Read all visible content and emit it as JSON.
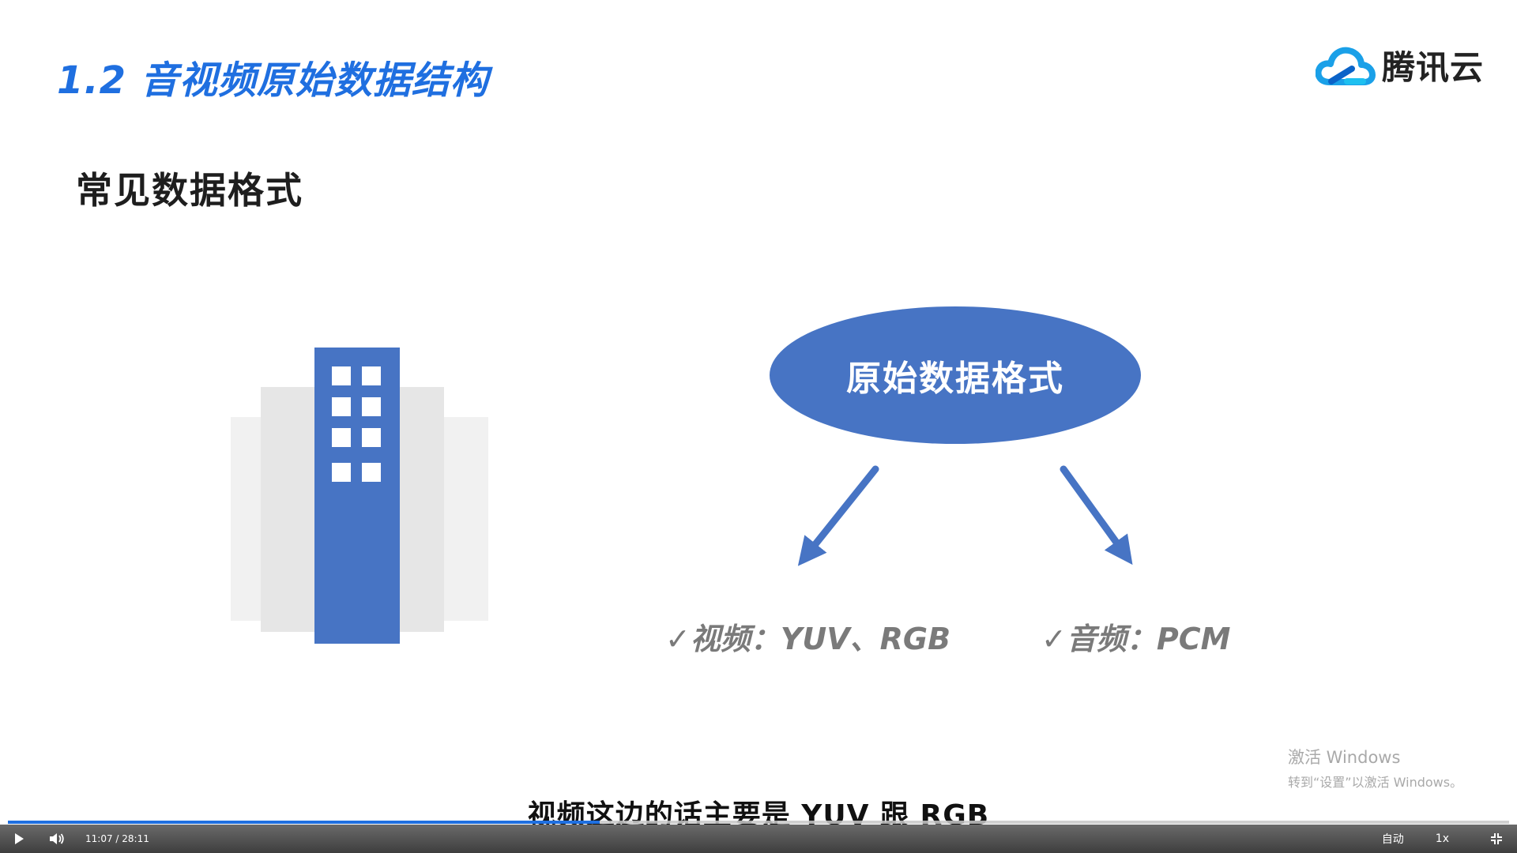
{
  "slide": {
    "title": "1.2 音视频原始数据结构",
    "heading": "常见数据格式",
    "logo_text": "腾讯云",
    "diagram": {
      "center_label": "原始数据格式",
      "video_item": "✓视频：YUV、RGB",
      "audio_item": "✓音频：PCM"
    }
  },
  "colors": {
    "accent": "#1f6fe0",
    "diagram_blue": "#4774c4",
    "building_gray_light": "#f1f1f1",
    "building_gray": "#e6e6e6"
  },
  "watermark": {
    "title": "激活 Windows",
    "subtitle": "转到“设置”以激活 Windows。"
  },
  "caption": "视频这边的话主要是 YUV 跟 RGB",
  "player": {
    "time": "11:07 / 28:11",
    "progress": 0.394,
    "quality": "自动",
    "speed": "1x",
    "icons": [
      "play-icon",
      "volume-icon",
      "fullscreen-exit-icon"
    ]
  }
}
